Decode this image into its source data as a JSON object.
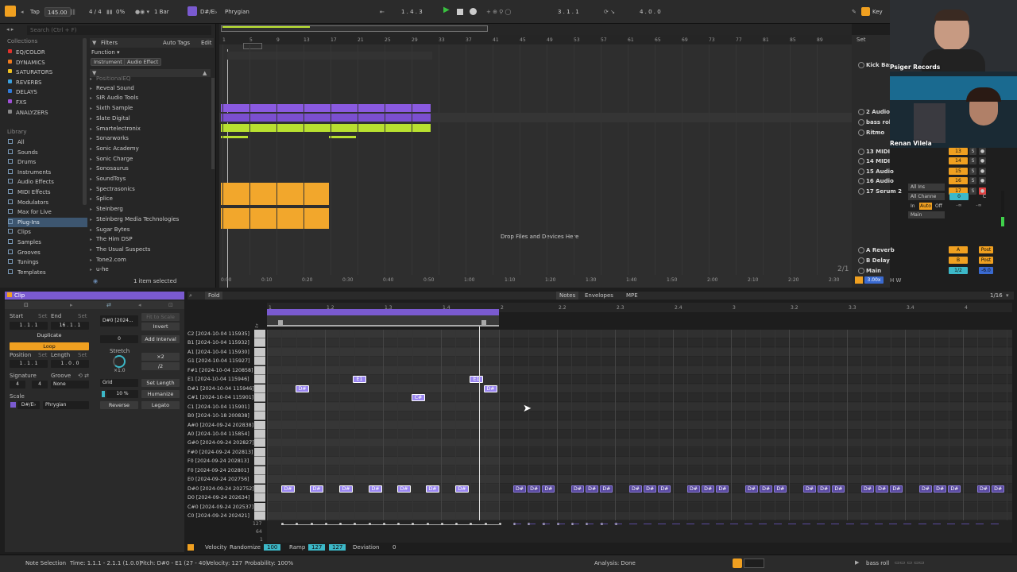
{
  "topbar": {
    "tap": "Tap",
    "tempo": "145.00",
    "signature": "4 / 4",
    "cpu": "0%",
    "quantize": "1 Bar",
    "scale_root": "D#/E♭",
    "scale_mode": "Phrygian",
    "position": "1 .  4 .  3",
    "loop_start": "3 .  1 .  1",
    "loop_length": "4 .  0 .  0",
    "key": "Key"
  },
  "browser": {
    "search_placeholder": "Search (Ctrl + F)",
    "collections_title": "Collections",
    "collections": [
      {
        "label": "EQ/COLOR",
        "color": "#e0322c"
      },
      {
        "label": "DYNAMICS",
        "color": "#f07a1e"
      },
      {
        "label": "SATURATORS",
        "color": "#f0c020"
      },
      {
        "label": "REVERBS",
        "color": "#3aa0e0"
      },
      {
        "label": "DELAYS",
        "color": "#2f7ad8"
      },
      {
        "label": "FXS",
        "color": "#a050d8"
      },
      {
        "label": "ANALYZERS",
        "color": "#888888"
      }
    ],
    "library_title": "Library",
    "library": [
      "All",
      "Sounds",
      "Drums",
      "Instruments",
      "Audio Effects",
      "MIDI Effects",
      "Modulators",
      "Max for Live",
      "Plug-Ins",
      "Clips",
      "Samples",
      "Grooves",
      "Tunings",
      "Templates"
    ],
    "filters": "Filters",
    "auto_tags": "Auto Tags",
    "edit": "Edit",
    "function": "Function ▾",
    "instrument": "Instrument",
    "audio_effect": "Audio Effect",
    "plugins": [
      "PositionalEQ",
      "Reveal Sound",
      "SIR Audio Tools",
      "Sixth Sample",
      "Slate Digital",
      "Smartelectronix",
      "Sonarworks",
      "Sonic Academy",
      "Sonic Charge",
      "Sonosaurus",
      "SoundToys",
      "Spectrasonics",
      "Splice",
      "Steinberg",
      "Steinberg Media Technologies",
      "Sugar Bytes",
      "The Him DSP",
      "The Usual Suspects",
      "Tone2.com",
      "u-he"
    ],
    "status": "1 item selected"
  },
  "arrangement": {
    "ruler": [
      "1",
      "5",
      "9",
      "13",
      "17",
      "21",
      "25",
      "29",
      "33",
      "37",
      "41",
      "45",
      "49",
      "53",
      "57",
      "61",
      "65",
      "69",
      "73",
      "77",
      "81",
      "85",
      "89"
    ],
    "time_ruler": [
      "0:00",
      "0:10",
      "0:20",
      "0:30",
      "0:40",
      "0:50",
      "1:00",
      "1:10",
      "1:20",
      "1:30",
      "1:40",
      "1:50",
      "2:00",
      "2:10",
      "2:20",
      "2:30"
    ],
    "drop_text": "Drop Files and Devices Here",
    "ratio": "2/1"
  },
  "mixer": {
    "set": "Set",
    "tracks": [
      {
        "name": "Kick Bass",
        "num": ""
      },
      {
        "name": "2 Audio",
        "num": ""
      },
      {
        "name": "bass roll",
        "num": ""
      },
      {
        "name": "Ritmo",
        "num": ""
      },
      {
        "name": "13 MIDI",
        "num": "13"
      },
      {
        "name": "14 MIDI",
        "num": "14"
      },
      {
        "name": "15 Audio",
        "num": "15"
      },
      {
        "name": "16 Audio",
        "num": "16"
      },
      {
        "name": "17 Serum 2",
        "num": "17"
      }
    ],
    "input_all": "All Ins",
    "input_channel": "All Channe",
    "monitor": [
      "In",
      "Auto",
      "Off"
    ],
    "output": "Main",
    "vol_val": "0",
    "pan_val": "C",
    "inf1": "-∞",
    "inf2": "-∞",
    "returns": [
      {
        "name": "A Reverb",
        "letter": "A"
      },
      {
        "name": "B Delay",
        "letter": "B"
      },
      {
        "name": "Main",
        "letter": "1/2"
      }
    ],
    "post": "Post",
    "zoom": "3.00x",
    "main_db": "-6.0"
  },
  "webcam": {
    "label_top": "Psiger Records",
    "label_bottom": "Renan Vilela"
  },
  "clip": {
    "title": "Clip",
    "start": "Start",
    "end": "End",
    "set": "Set",
    "start_val": "1 .  1 .  1",
    "end_val": "16 .  1 .  1",
    "duplicate": "Duplicate",
    "loop": "Loop",
    "position": "Position",
    "length": "Length",
    "pos_val": "1 .  1 .  1",
    "len_val": "1 .  0 .  0",
    "signature": "Signature",
    "groove": "Groove",
    "sig_num": "4",
    "sig_den": "4",
    "groove_val": "None",
    "scale": "Scale",
    "scale_root": "D#/E♭",
    "scale_mode": "Phrygian",
    "note_name": "D#0 [2024...",
    "fit_to_scale": "Fit to Scale",
    "invert": "Invert",
    "transpose": "0",
    "add_interval": "Add Interval",
    "stretch": "Stretch",
    "x2": "×2",
    "div2": "/2",
    "stretch_val": "×1.0",
    "grid": "Grid",
    "set_length": "Set Length",
    "humanize_pct": "10 %",
    "humanize": "Humanize",
    "reverse": "Reverse",
    "legato": "Legato"
  },
  "editor": {
    "fold": "Fold",
    "tabs": [
      "Notes",
      "Envelopes",
      "MPE"
    ],
    "grid_val": "1/16",
    "ruler": [
      "1",
      "1.2",
      "1.3",
      "1.4",
      "2",
      "2.2",
      "2.3",
      "2.4",
      "3",
      "3.2",
      "3.3",
      "3.4",
      "4"
    ],
    "keys": [
      "C2 [2024-10-04 115935]",
      "B1 [2024-10-04 115932]",
      "A1 [2024-10-04 115930]",
      "G1 [2024-10-04 115927]",
      "F#1 [2024-10-04 120858]",
      "E1 [2024-10-04 115946]",
      "D#1 [2024-10-04 115946]",
      "C#1 [2024-10-04 115901]",
      "C1 [2024-10-04 115901]",
      "B0 [2024-10-18 200838]",
      "A#0 [2024-09-24 202838]",
      "A0 [2024-10-04 115854]",
      "G#0 [2024-09-24 202827]",
      "F#0 [2024-09-24 202813]",
      "F0 [2024-09-24 202813]",
      "F0 [2024-09-24 202801]",
      "E0 [2024-09-24 202756]",
      "D#0 [2024-09-24 202752]",
      "D0 [2024-09-24 202634]",
      "C#0 [2024-09-24 202537]",
      "C0 [2024-09-24 202421]"
    ],
    "vel_ticks": [
      "127",
      "64",
      "1"
    ],
    "velocity": "Velocity",
    "randomize": "Randomize",
    "rand_val": "100",
    "ramp": "Ramp",
    "ramp_a": "127",
    "ramp_b": "127",
    "deviation": "Deviation",
    "dev_val": "0",
    "upper_notes": [
      {
        "label": "D#"
      },
      {
        "label": "E1"
      },
      {
        "label": "C#"
      },
      {
        "label": "E1"
      },
      {
        "label": "D#"
      }
    ],
    "note_label": "D#"
  },
  "statusbar": {
    "note_selection": "Note Selection",
    "time": "Time: 1.1.1 - 2.1.1 (1.0.0)",
    "pitch": "Pitch: D#0 - E1 (27 - 40)",
    "velocity": "Velocity: 127",
    "probability": "Probability: 100%",
    "analysis": "Analysis: Done",
    "track": "bass roll"
  }
}
